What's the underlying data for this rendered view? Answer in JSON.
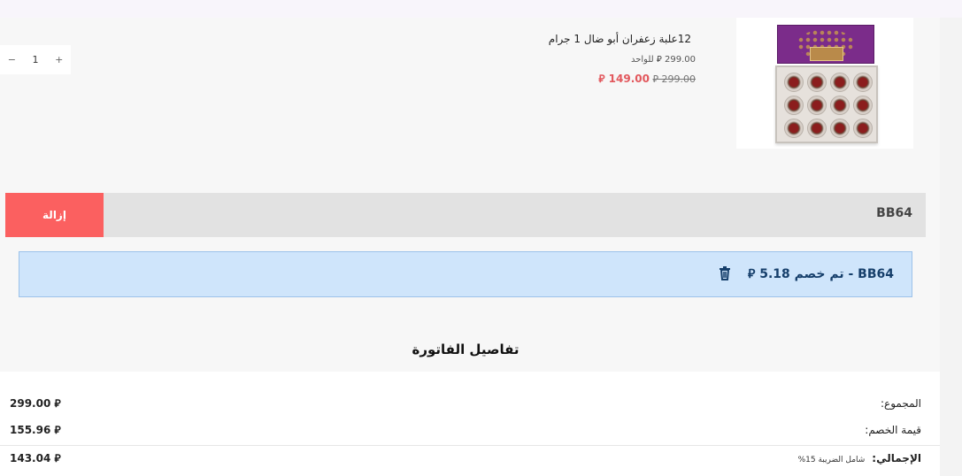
{
  "product": {
    "title": "12علبة زعفران أبو ضال 1 جرام",
    "unit_price": "299.00 ⃁ للواحد",
    "old_price": "⃁ 299.00",
    "new_price": "⃁ 149.00",
    "quantity": "1",
    "qty_minus": "−",
    "qty_plus": "+"
  },
  "coupon": {
    "code": "BB64",
    "remove_label": "إزالة",
    "applied_text": "BB64 - تم خصم 5.18 ⃁"
  },
  "invoice": {
    "title": "تفاصيل الفاتورة",
    "rows": [
      {
        "label": "المجموع:",
        "value": "299.00 ⃁"
      },
      {
        "label": "قيمة الخصم:",
        "value": "155.96 ⃁"
      },
      {
        "label": "الإجمالي:",
        "value": "143.04 ⃁",
        "note": "شامل الضريبة 15%"
      }
    ]
  },
  "colors": {
    "remove_button": "#fb6060",
    "sale_price": "#e2585d",
    "notice_bg": "#cfe5fb",
    "notice_text": "#163f6b"
  }
}
